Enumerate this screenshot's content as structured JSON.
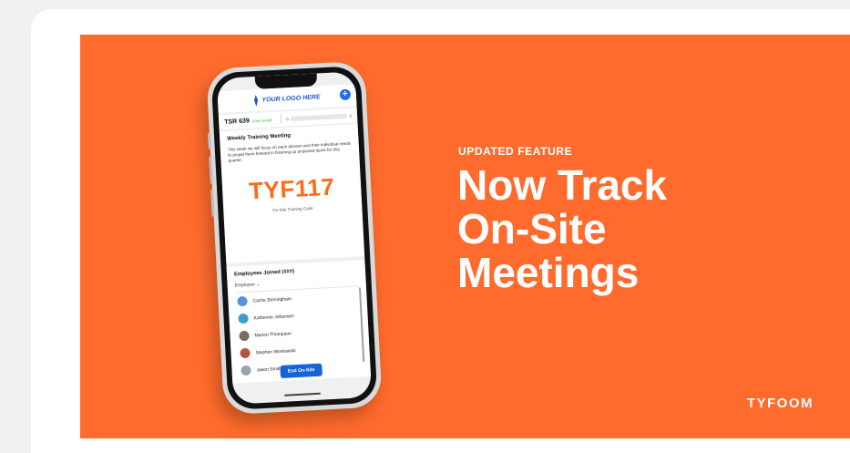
{
  "banner": {
    "eyebrow": "UPDATED FEATURE",
    "headline_line1": "Now Track",
    "headline_line2": "On-Site",
    "headline_line3": "Meetings",
    "brand": "TYFOOM",
    "color": "#ff6b2c"
  },
  "phone": {
    "logo_text": "YOUR LOGO HERE",
    "plus_icon": "plus-icon",
    "tsr": {
      "label": "TSR 639",
      "status": "(Very Good)",
      "left_num": "0",
      "right_num": "2"
    },
    "meeting": {
      "title": "Weekly Training Meeting",
      "description": "This week we will focus on each division and their individual needs to propel them forward in finishing up projected items for this quarter.",
      "code": "TYF117",
      "code_label": "On-Site Training Code"
    },
    "employees": {
      "title": "Employees Joined (###)",
      "filter": "Employee",
      "list": [
        {
          "name": "Cache Birmingham",
          "avatar_color": "#5b8fd6"
        },
        {
          "name": "Katherine Johansen",
          "avatar_color": "#3aa0c8"
        },
        {
          "name": "Marion Thompson",
          "avatar_color": "#7a6a62"
        },
        {
          "name": "Stephen Workowski",
          "avatar_color": "#b5553f"
        },
        {
          "name": "Jason Smithers",
          "avatar_color": "#9aa4b0"
        }
      ]
    },
    "end_button": "End On-Site"
  }
}
